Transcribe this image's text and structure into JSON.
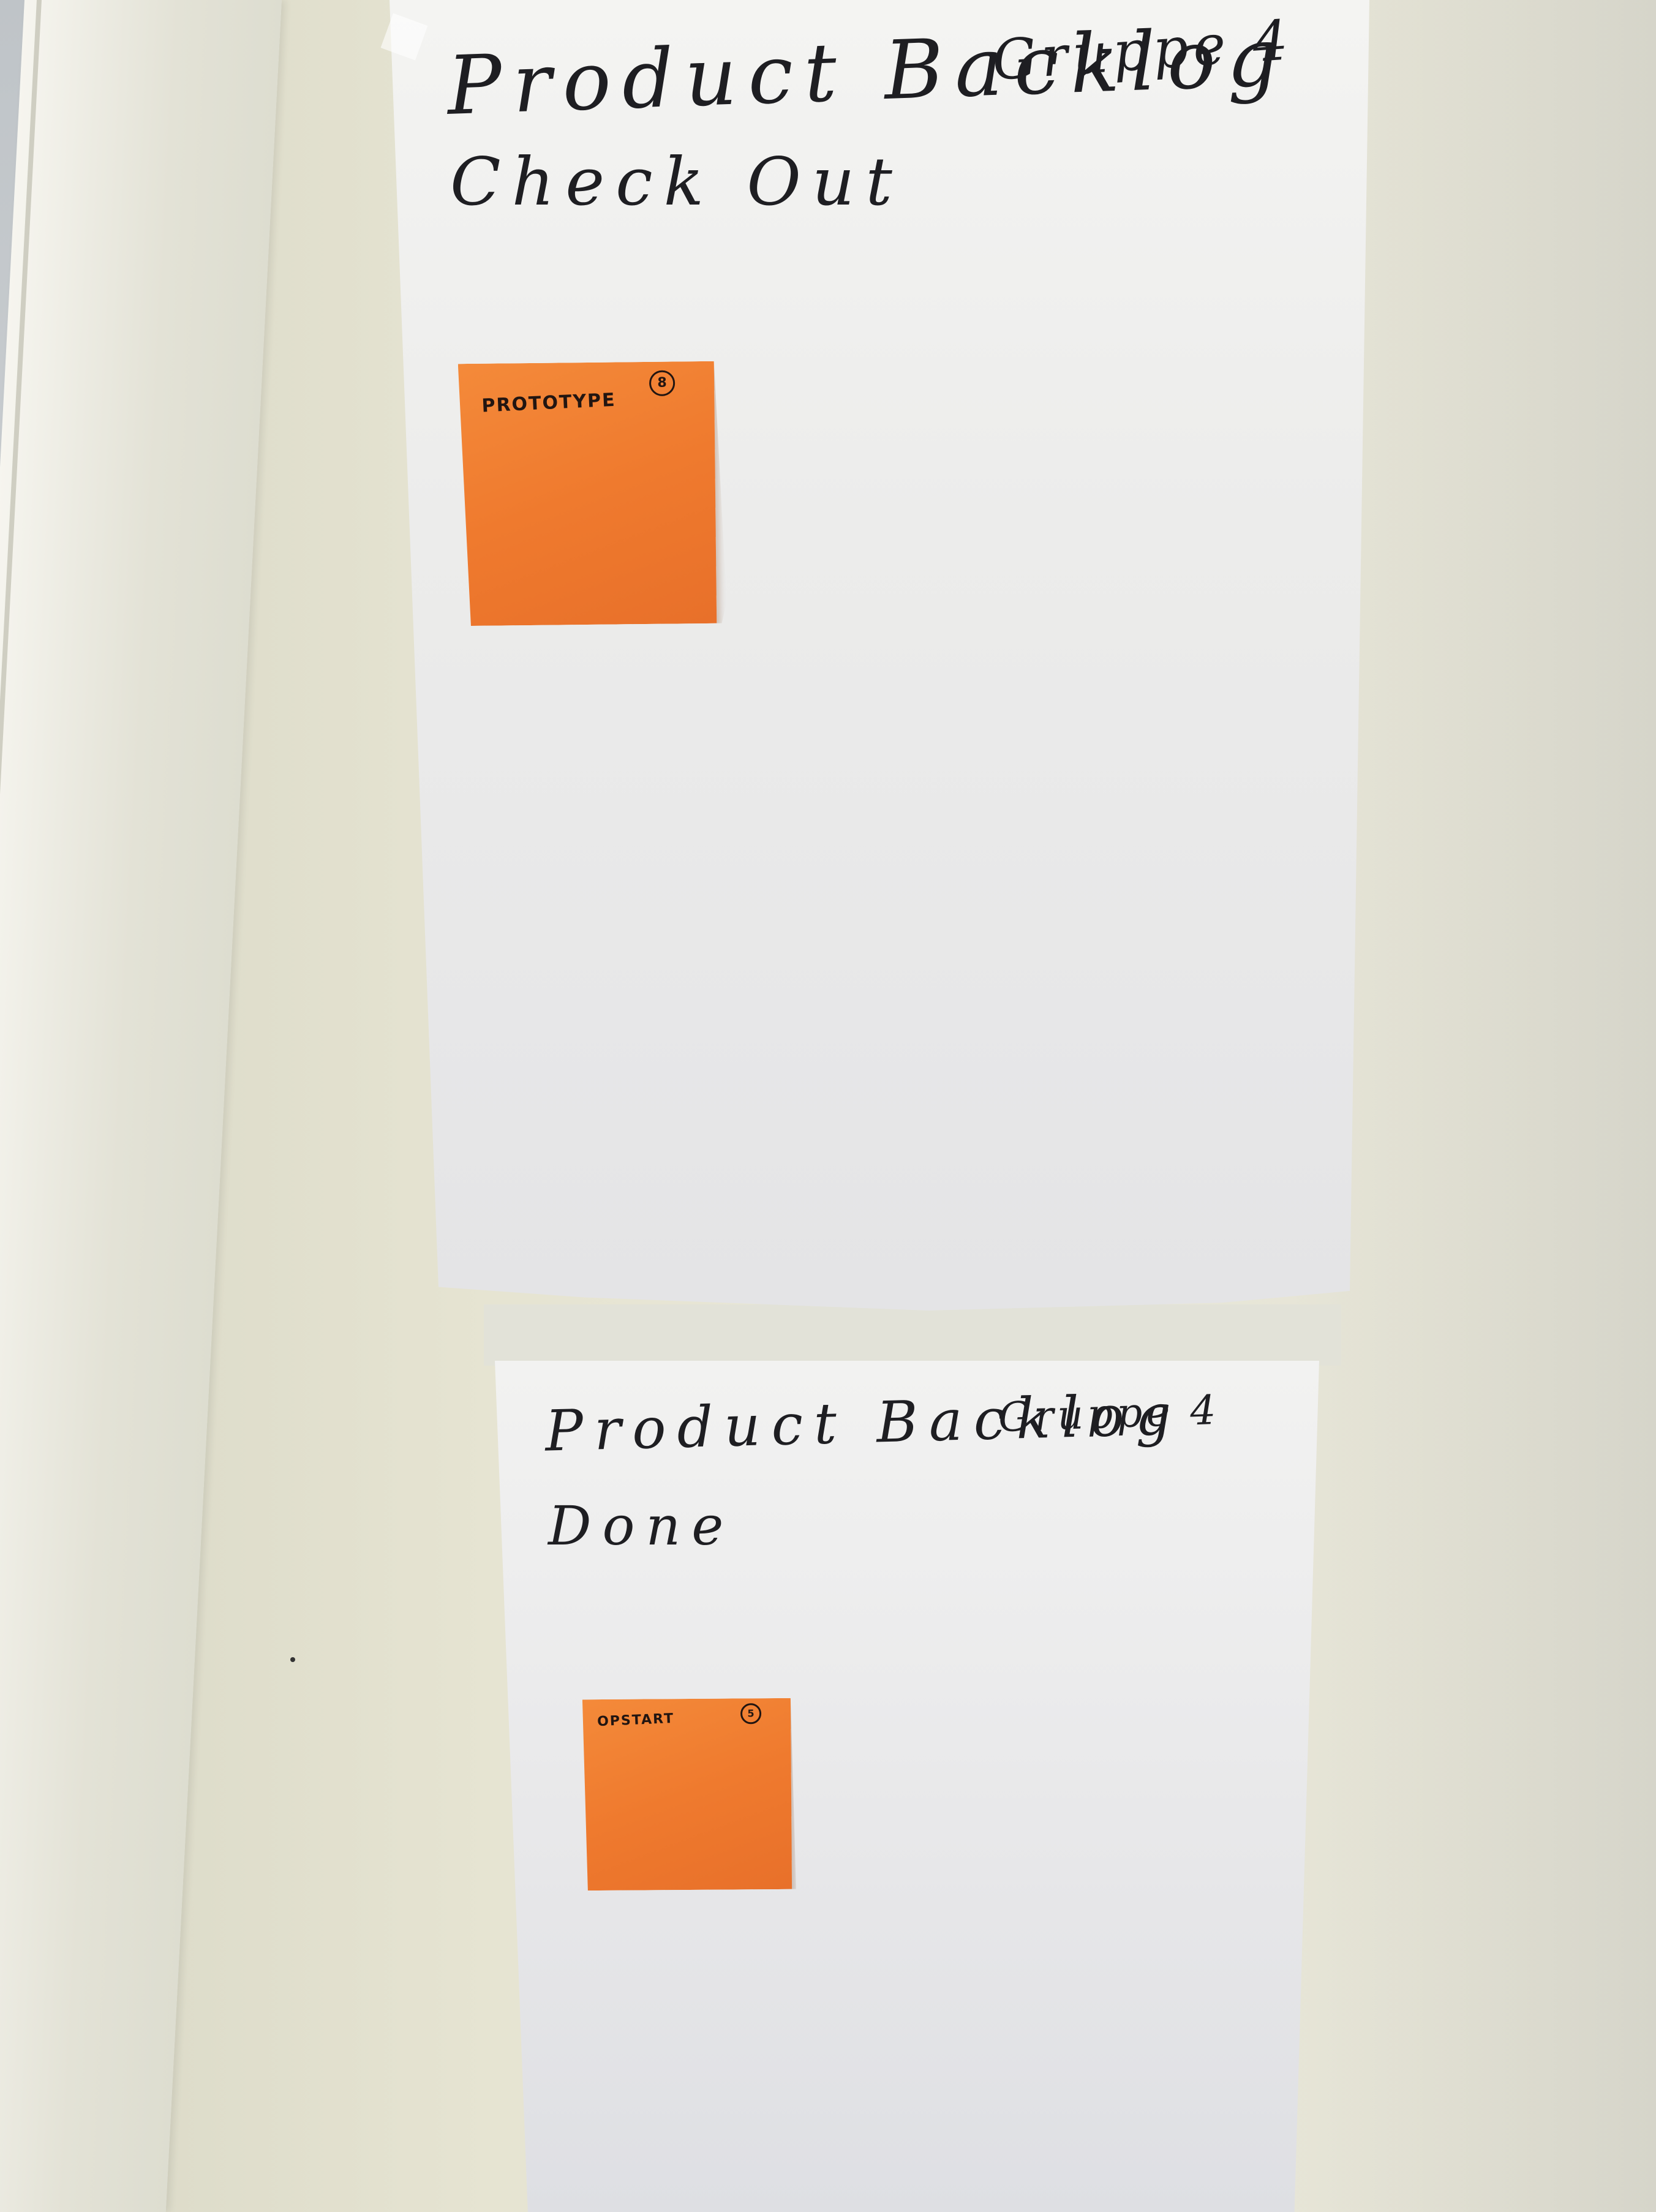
{
  "board_top": {
    "title_line1": "Product Backlog",
    "title_group": "Gruppe 4",
    "title_line2": "Check Out",
    "sticky": {
      "label": "PROTOTYPE",
      "points": "8"
    }
  },
  "board_bottom": {
    "title_line1": "Product Backlog",
    "title_group": "Gruppe 4",
    "title_line2": "Done",
    "sticky": {
      "label": "OPSTART",
      "points": "5"
    }
  },
  "colors": {
    "sticky_note": "#ef7a2e",
    "paper": "#ececeb",
    "wall": "#e6e4d2"
  }
}
